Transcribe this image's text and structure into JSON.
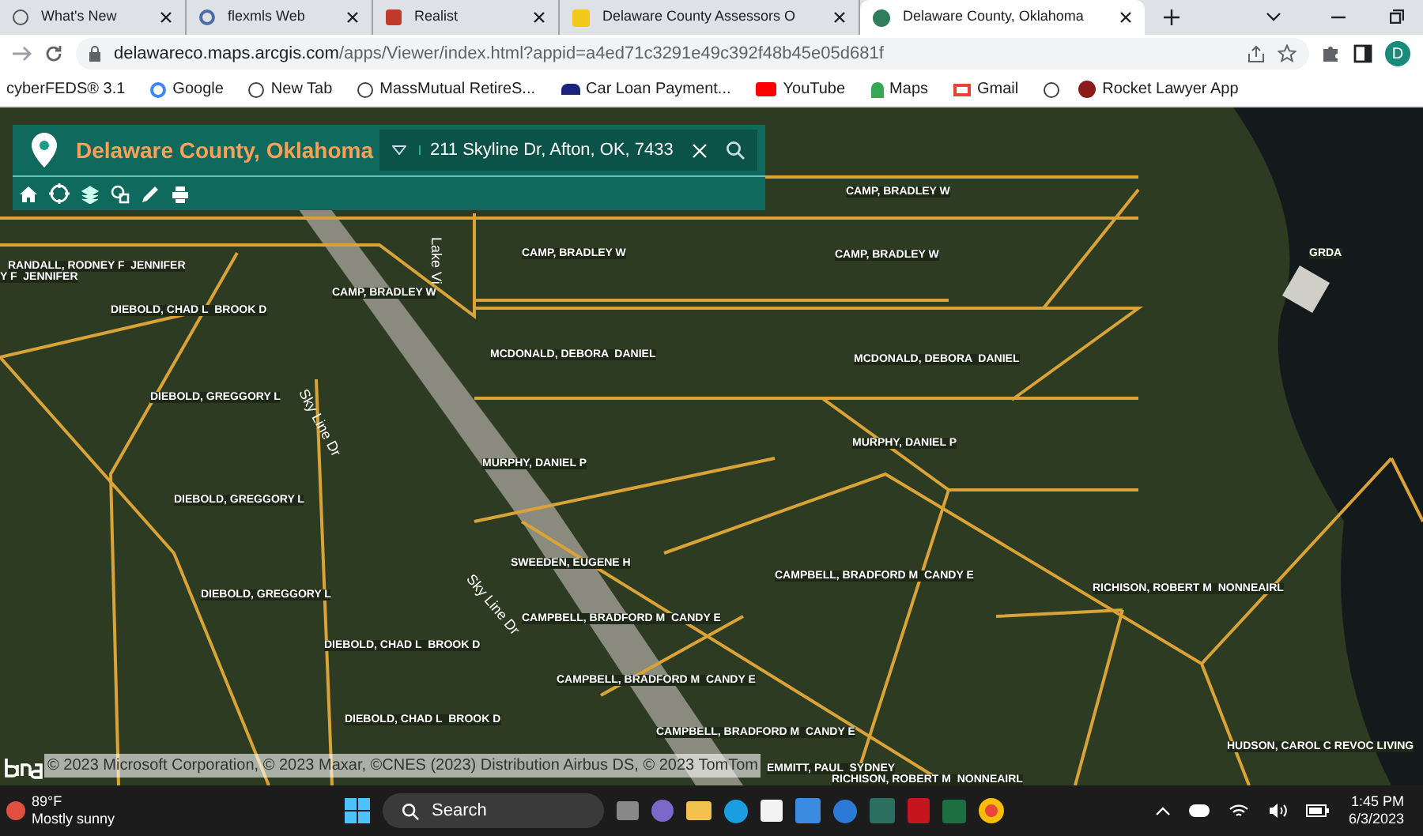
{
  "tabs": [
    {
      "title": "What's New",
      "selected": false
    },
    {
      "title": "flexmls Web",
      "selected": false
    },
    {
      "title": "Realist",
      "selected": false
    },
    {
      "title": "Delaware County Assessors O",
      "selected": false
    },
    {
      "title": "Delaware County, Oklahoma",
      "selected": true
    }
  ],
  "address_bar": {
    "domain": "delawareco.maps.arcgis.com",
    "path": "/apps/Viewer/index.html?appid=a4ed71c3291e49c392f48b45e05d681f"
  },
  "profile_initial": "D",
  "bookmarks": [
    "cyberFEDS® 3.1",
    "Google",
    "New Tab",
    "MassMutual RetireS...",
    "Car Loan Payment...",
    "YouTube",
    "Maps",
    "Gmail",
    "Rocket Lawyer App"
  ],
  "app_header": {
    "title": "Delaware County, Oklahoma",
    "search_value": "211 Skyline Dr, Afton, OK, 7433"
  },
  "parcel_labels": [
    "CAMP, BRADLEY W",
    "RANDALL, RODNEY F  JENNIFER",
    "Y F  JENNIFER",
    "CAMP, BRADLEY W",
    "CAMP, BRADLEY W",
    "GRDA",
    "CAMP, BRADLEY W",
    "DIEBOLD, CHAD L  BROOK D",
    "MCDONALD, DEBORA  DANIEL",
    "MCDONALD, DEBORA  DANIEL",
    "DIEBOLD, GREGGORY L",
    "MURPHY, DANIEL P",
    "MURPHY, DANIEL P",
    "DIEBOLD, GREGGORY L",
    "SWEEDEN, EUGENE H",
    "CAMPBELL, BRADFORD M  CANDY E",
    "RICHISON, ROBERT M  NONNEAIRL",
    "DIEBOLD, GREGGORY L",
    "CAMPBELL, BRADFORD M  CANDY E",
    "DIEBOLD, CHAD L  BROOK D",
    "CAMPBELL, BRADFORD M  CANDY E",
    "DIEBOLD, CHAD L  BROOK D",
    "CAMPBELL, BRADFORD M  CANDY E",
    "HUDSON, CAROL C REVOC LIVING",
    "EMMITT, PAUL  SYDNEY",
    "RICHISON, ROBERT M  NONNEAIRL"
  ],
  "street_labels": [
    "Lake Vi",
    "Sky Line Dr",
    "Sky Line Dr"
  ],
  "attribution": "© 2023 Microsoft Corporation, © 2023 Maxar, ©CNES (2023) Distribution Airbus DS, © 2023 TomTom",
  "taskbar": {
    "temperature": "89°F",
    "weather": "Mostly sunny",
    "search": "Search",
    "time": "1:45 PM",
    "date": "6/3/2023"
  }
}
